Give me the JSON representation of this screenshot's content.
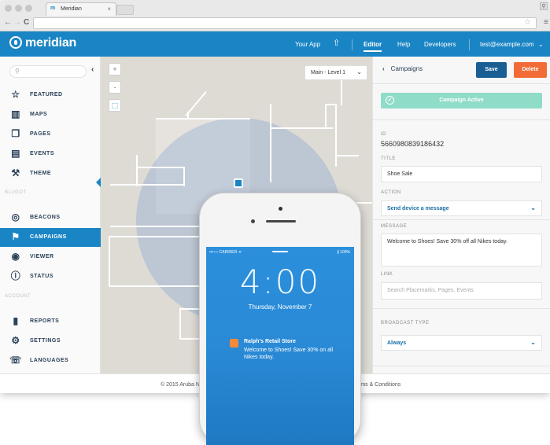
{
  "browser": {
    "tab_title": "Meridian",
    "tab_close": "×",
    "nav_back": "←",
    "nav_forward": "→",
    "nav_reload": "C"
  },
  "header": {
    "logo": "meridian",
    "nav": [
      {
        "label": "Your App"
      },
      {
        "label": "Editor"
      },
      {
        "label": "Help"
      },
      {
        "label": "Developers"
      },
      {
        "label": "test@example.com"
      }
    ]
  },
  "sidebar": {
    "search_placeholder": "",
    "items_top": [
      {
        "label": "FEATURED",
        "icon": "star-icon"
      },
      {
        "label": "MAPS",
        "icon": "map-icon"
      },
      {
        "label": "PAGES",
        "icon": "pages-icon"
      },
      {
        "label": "EVENTS",
        "icon": "events-icon"
      },
      {
        "label": "THEME",
        "icon": "theme-icon"
      }
    ],
    "group_blugot": "BLUGOT",
    "items_mid": [
      {
        "label": "BEACONS",
        "icon": "beacon-icon"
      },
      {
        "label": "CAMPAIGNS",
        "icon": "flag-icon",
        "active": true
      },
      {
        "label": "VIEWER",
        "icon": "eye-icon"
      },
      {
        "label": "STATUS",
        "icon": "info-icon"
      }
    ],
    "group_account": "ACCOUNT",
    "items_bottom": [
      {
        "label": "REPORTS",
        "icon": "reports-icon"
      },
      {
        "label": "SETTINGS",
        "icon": "gear-icon"
      },
      {
        "label": "LANGUAGES",
        "icon": "languages-icon"
      }
    ]
  },
  "map": {
    "zoom_in": "+",
    "zoom_out": "-",
    "level": "Main - Level 1"
  },
  "panel": {
    "title": "Campaigns",
    "save": "Save",
    "delete": "Delete",
    "status": "Campaign Active",
    "id_label": "ID",
    "id_value": "5660980839186432",
    "title_label": "TITLE",
    "title_value": "Shoe Sale",
    "action_label": "ACTION",
    "action_value": "Send device a message",
    "message_label": "MESSAGE",
    "message_value": "Welcome to Shoes! Save 30% off all Nikes today.",
    "link_label": "LINK",
    "link_placeholder": "Search Placemarks, Pages, Events",
    "broadcast_label": "BROADCAST TYPE",
    "broadcast_value": "Always"
  },
  "footer": {
    "copyright": "© 2015 Aruba N",
    "terms": "rms & Conditions"
  },
  "phone": {
    "carrier": "•••○○ CARRIER ᯤ",
    "battery": "∦ 100%",
    "time": "4:00",
    "date": "Thursday, November 7",
    "notif_title": "Ralph's Retail Store",
    "notif_body": "Welcome to Shoes! Save 30% on all Nikes today."
  },
  "colors": {
    "brand_blue": "#1a85c4",
    "save_blue": "#1a5f93",
    "delete_orange": "#f26c38",
    "active_green": "#8fdcc8"
  }
}
